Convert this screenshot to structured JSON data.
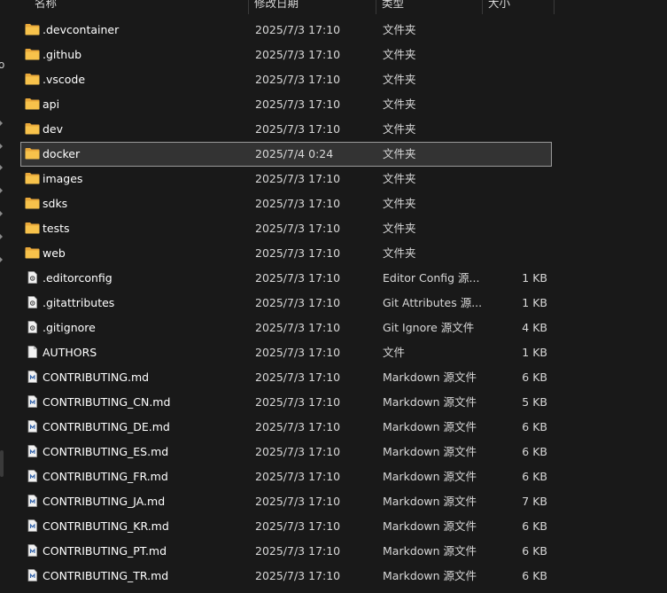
{
  "header": {
    "name": "名称",
    "date": "修改日期",
    "type": "类型",
    "size": "大小"
  },
  "nav": {
    "fragment": "o"
  },
  "colors": {
    "background": "#191919",
    "folder": "#f7c24b",
    "selected_bg": "#333333",
    "selected_border": "#9a9a9a"
  },
  "files": [
    {
      "name": ".devcontainer",
      "date": "2025/7/3 17:10",
      "type": "文件夹",
      "size": "",
      "icon": "folder-icon"
    },
    {
      "name": ".github",
      "date": "2025/7/3 17:10",
      "type": "文件夹",
      "size": "",
      "icon": "folder-icon"
    },
    {
      "name": ".vscode",
      "date": "2025/7/3 17:10",
      "type": "文件夹",
      "size": "",
      "icon": "folder-icon"
    },
    {
      "name": "api",
      "date": "2025/7/3 17:10",
      "type": "文件夹",
      "size": "",
      "icon": "folder-icon"
    },
    {
      "name": "dev",
      "date": "2025/7/3 17:10",
      "type": "文件夹",
      "size": "",
      "icon": "folder-icon"
    },
    {
      "name": "docker",
      "date": "2025/7/4 0:24",
      "type": "文件夹",
      "size": "",
      "icon": "folder-icon",
      "selected": true
    },
    {
      "name": "images",
      "date": "2025/7/3 17:10",
      "type": "文件夹",
      "size": "",
      "icon": "folder-icon"
    },
    {
      "name": "sdks",
      "date": "2025/7/3 17:10",
      "type": "文件夹",
      "size": "",
      "icon": "folder-icon"
    },
    {
      "name": "tests",
      "date": "2025/7/3 17:10",
      "type": "文件夹",
      "size": "",
      "icon": "folder-icon"
    },
    {
      "name": "web",
      "date": "2025/7/3 17:10",
      "type": "文件夹",
      "size": "",
      "icon": "folder-icon"
    },
    {
      "name": ".editorconfig",
      "date": "2025/7/3 17:10",
      "type": "Editor Config 源...",
      "size": "1 KB",
      "icon": "config-file-icon"
    },
    {
      "name": ".gitattributes",
      "date": "2025/7/3 17:10",
      "type": "Git Attributes 源...",
      "size": "1 KB",
      "icon": "config-file-icon"
    },
    {
      "name": ".gitignore",
      "date": "2025/7/3 17:10",
      "type": "Git Ignore 源文件",
      "size": "4 KB",
      "icon": "config-file-icon"
    },
    {
      "name": "AUTHORS",
      "date": "2025/7/3 17:10",
      "type": "文件",
      "size": "1 KB",
      "icon": "file-icon"
    },
    {
      "name": "CONTRIBUTING.md",
      "date": "2025/7/3 17:10",
      "type": "Markdown 源文件",
      "size": "6 KB",
      "icon": "markdown-file-icon"
    },
    {
      "name": "CONTRIBUTING_CN.md",
      "date": "2025/7/3 17:10",
      "type": "Markdown 源文件",
      "size": "5 KB",
      "icon": "markdown-file-icon"
    },
    {
      "name": "CONTRIBUTING_DE.md",
      "date": "2025/7/3 17:10",
      "type": "Markdown 源文件",
      "size": "6 KB",
      "icon": "markdown-file-icon"
    },
    {
      "name": "CONTRIBUTING_ES.md",
      "date": "2025/7/3 17:10",
      "type": "Markdown 源文件",
      "size": "6 KB",
      "icon": "markdown-file-icon"
    },
    {
      "name": "CONTRIBUTING_FR.md",
      "date": "2025/7/3 17:10",
      "type": "Markdown 源文件",
      "size": "6 KB",
      "icon": "markdown-file-icon"
    },
    {
      "name": "CONTRIBUTING_JA.md",
      "date": "2025/7/3 17:10",
      "type": "Markdown 源文件",
      "size": "7 KB",
      "icon": "markdown-file-icon"
    },
    {
      "name": "CONTRIBUTING_KR.md",
      "date": "2025/7/3 17:10",
      "type": "Markdown 源文件",
      "size": "6 KB",
      "icon": "markdown-file-icon"
    },
    {
      "name": "CONTRIBUTING_PT.md",
      "date": "2025/7/3 17:10",
      "type": "Markdown 源文件",
      "size": "6 KB",
      "icon": "markdown-file-icon"
    },
    {
      "name": "CONTRIBUTING_TR.md",
      "date": "2025/7/3 17:10",
      "type": "Markdown 源文件",
      "size": "6 KB",
      "icon": "markdown-file-icon"
    }
  ]
}
